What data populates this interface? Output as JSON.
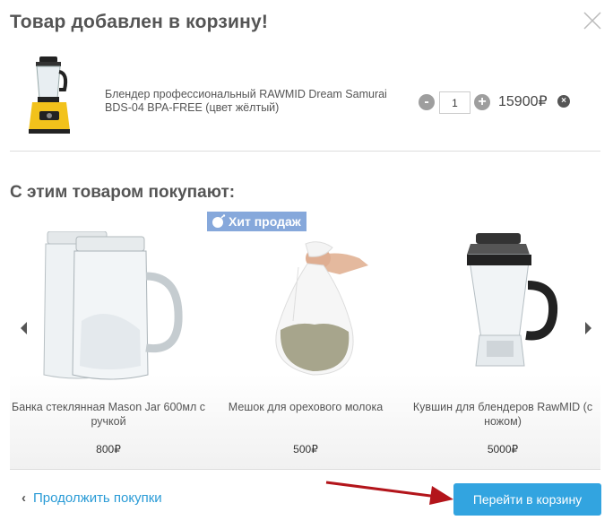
{
  "modal": {
    "title": "Товар добавлен в корзину!",
    "close_icon": "close-icon"
  },
  "cart_item": {
    "name": "Блендер профессиональный RAWMID Dream Samurai BDS-04 BPA-FREE (цвет жёлтый)",
    "quantity": "1",
    "minus_label": "-",
    "plus_label": "+",
    "price": "15900₽",
    "remove_label": "×"
  },
  "recommendations": {
    "title": "С этим товаром покупают:",
    "badge": "Хит продаж",
    "items": [
      {
        "name": "Банка стеклянная Mason Jar 600мл с ручкой",
        "price": "800₽",
        "image": "mason-jar-image"
      },
      {
        "name": "Мешок для орехового молока",
        "price": "500₽",
        "image": "nut-milk-bag-image"
      },
      {
        "name": "Кувшин для блендеров RawMID (с ножом)",
        "price": "5000₽",
        "image": "blender-jug-image"
      }
    ]
  },
  "footer": {
    "continue_label": "Продолжить покупки",
    "checkout_label": "Перейти в корзину"
  },
  "colors": {
    "accent": "#32a4e0",
    "link": "#2a9bd6",
    "badge": "#86a8db",
    "annotation_arrow": "#b3151b"
  }
}
